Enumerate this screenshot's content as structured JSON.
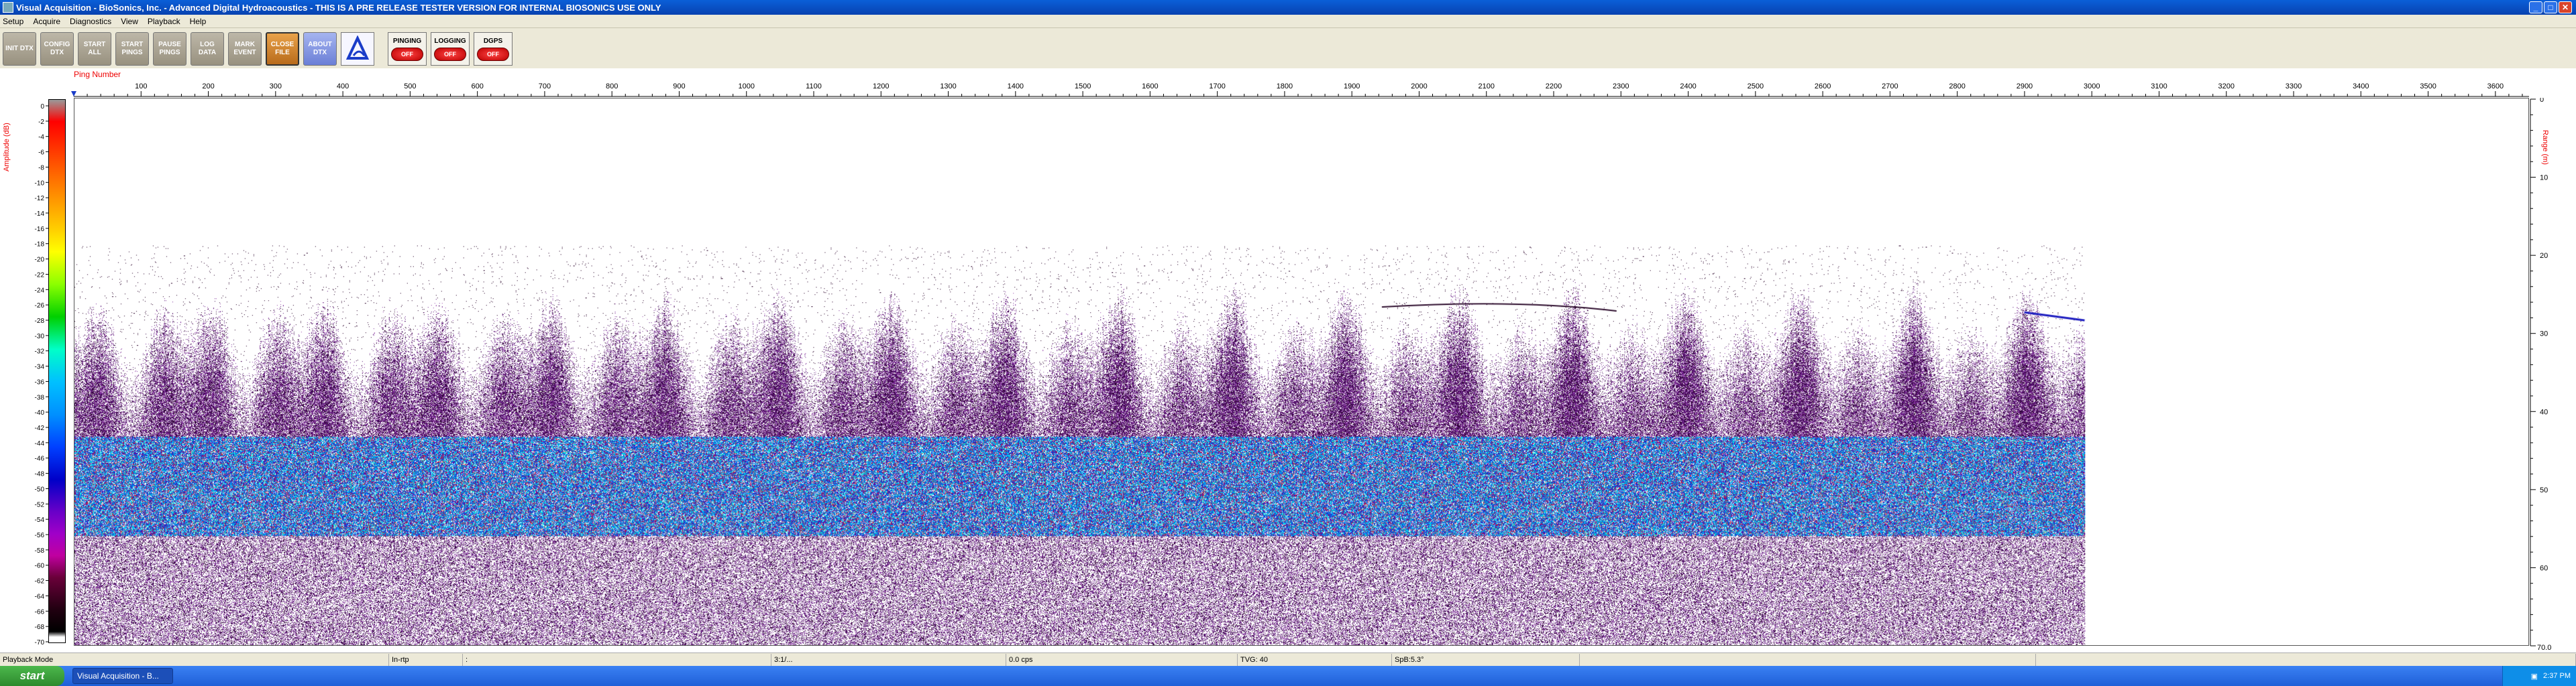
{
  "window": {
    "title": "Visual Acquisition  -  BioSonics, Inc.  -  Advanced Digital Hydroacoustics  -  THIS IS A PRE RELEASE TESTER VERSION FOR INTERNAL BIOSONICS USE ONLY",
    "min_glyph": "_",
    "max_glyph": "□",
    "close_glyph": "✕"
  },
  "menu": [
    "Setup",
    "Acquire",
    "Diagnostics",
    "View",
    "Playback",
    "Help"
  ],
  "toolbar": {
    "buttons": [
      {
        "label": "INIT DTX",
        "style": "grey"
      },
      {
        "label": "CONFIG DTX",
        "style": "grey"
      },
      {
        "label": "START ALL",
        "style": "grey"
      },
      {
        "label": "START PINGS",
        "style": "grey"
      },
      {
        "label": "PAUSE PINGS",
        "style": "grey"
      },
      {
        "label": "LOG DATA",
        "style": "grey"
      },
      {
        "label": "MARK EVENT",
        "style": "grey"
      },
      {
        "label": "CLOSE FILE",
        "style": "orange"
      },
      {
        "label": "ABOUT DTX",
        "style": "blue"
      }
    ],
    "indicators": [
      {
        "label": "PINGING",
        "state": "OFF"
      },
      {
        "label": "LOGGING",
        "state": "OFF"
      },
      {
        "label": "DGPS",
        "state": "OFF"
      }
    ]
  },
  "plot": {
    "x_axis_label": "Ping Number",
    "x_ticks": [
      100,
      200,
      300,
      400,
      500,
      600,
      700,
      800,
      900,
      1000,
      1100,
      1200,
      1300,
      1400,
      1500,
      1600,
      1700,
      1800,
      1900,
      2000,
      2100,
      2200,
      2300,
      2400,
      2500,
      2600,
      2700,
      2800,
      2900,
      3000,
      3100,
      3200,
      3300,
      3400,
      3500,
      3600
    ],
    "x_range": [
      0,
      3650
    ],
    "amplitude_label": "Amplitude (dB)",
    "amplitude_ticks": [
      0,
      -2,
      -4,
      -6,
      -8,
      -10,
      -12,
      -14,
      -16,
      -18,
      -20,
      -22,
      -24,
      -26,
      -28,
      -30,
      -32,
      -34,
      -36,
      -38,
      -40,
      -42,
      -44,
      -46,
      -48,
      -50,
      -52,
      -54,
      -56,
      -58,
      -60,
      -62,
      -64,
      -66,
      -68,
      -70
    ],
    "range_label": "Range (m)",
    "range_ticks": [
      0,
      10,
      20,
      30,
      40,
      50,
      60
    ],
    "range_max_label": "70.0",
    "range_max": 70,
    "data_end_ping": 2990
  },
  "status": {
    "fields": [
      "Playback Mode",
      "In-rtp",
      ":",
      "3:1/...",
      "0.0 cps",
      "TVG: 40",
      "SpB:5.3°",
      "",
      ""
    ]
  },
  "taskbar": {
    "start_label": "start",
    "task_label": "Visual Acquisition - B...",
    "clock": "2:37 PM"
  }
}
